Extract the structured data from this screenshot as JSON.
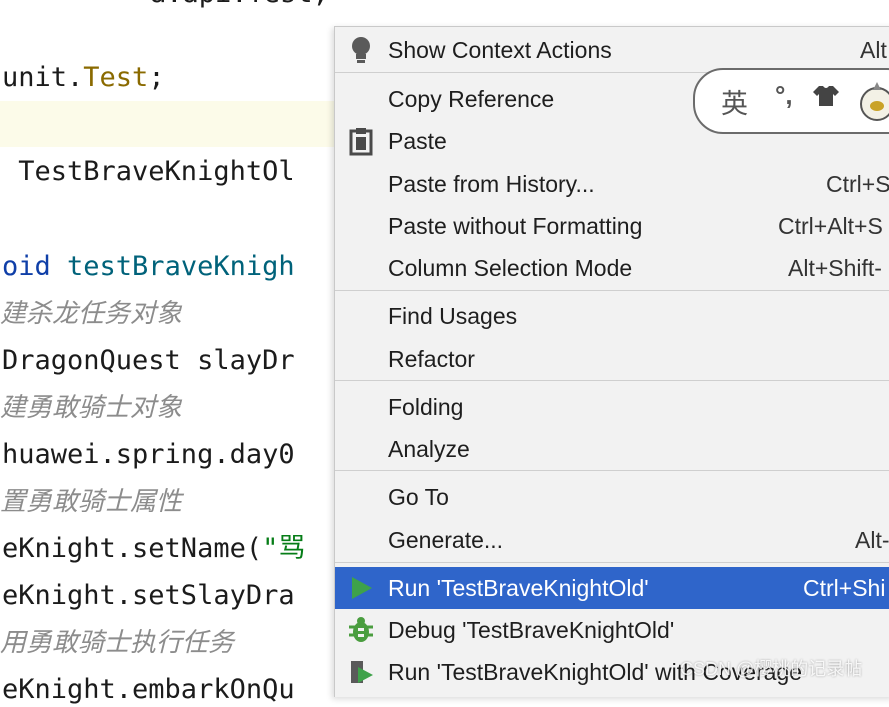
{
  "editor": {
    "top_partial": "a.api.Test;",
    "line1_a": "unit.",
    "line1_b": "Test",
    "line1_c": ";",
    "line2": " TestBraveKnightOl",
    "line3_a": "oid ",
    "line3_b": "testBraveKnigh",
    "comment1": "建杀龙任务对象",
    "line4": "DragonQuest slayDr",
    "comment2": "建勇敢骑士对象",
    "line5": "huawei.spring.day0",
    "comment3": "置勇敢骑士属性",
    "line6_a": "eKnight.setName(",
    "line6_b": "\"骂",
    "line7": "eKnight.setSlayDra",
    "comment4": "用勇敢骑士执行任务",
    "line8": "eKnight.embarkOnQu"
  },
  "context_menu": {
    "items": [
      {
        "label": "Show Context Actions",
        "shortcut": "Alt",
        "icon": "bulb-icon"
      },
      {
        "label": "Copy Reference",
        "shortcut": ""
      },
      {
        "label": "Paste",
        "shortcut": "",
        "icon": "clipboard-icon"
      },
      {
        "label": "Paste from History...",
        "shortcut": "Ctrl+S"
      },
      {
        "label": "Paste without Formatting",
        "shortcut": "Ctrl+Alt+S"
      },
      {
        "label": "Column Selection Mode",
        "shortcut": "Alt+Shift-"
      },
      {
        "label": "Find Usages",
        "shortcut": ""
      },
      {
        "label": "Refactor",
        "shortcut": ""
      },
      {
        "label": "Folding",
        "shortcut": ""
      },
      {
        "label": "Analyze",
        "shortcut": ""
      },
      {
        "label": "Go To",
        "shortcut": ""
      },
      {
        "label": "Generate...",
        "shortcut": "Alt-"
      },
      {
        "label": "Run 'TestBraveKnightOld'",
        "shortcut": "Ctrl+Shi",
        "icon": "run-icon"
      },
      {
        "label": "Debug 'TestBraveKnightOld'",
        "shortcut": "",
        "icon": "debug-icon"
      },
      {
        "label": "Run 'TestBraveKnightOld' with Coverage",
        "shortcut": "",
        "icon": "coverage-icon"
      }
    ],
    "selected_index": 12,
    "colors": {
      "selected_bg": "#2f65ca",
      "run_green": "#3ea24a",
      "debug_green": "#4a9d3f"
    }
  },
  "ime": {
    "char": "英",
    "punct": "°,",
    "icons": [
      "shirt-icon",
      "avatar-icon"
    ]
  },
  "watermark": "CSDN @樱桃的记录帖"
}
